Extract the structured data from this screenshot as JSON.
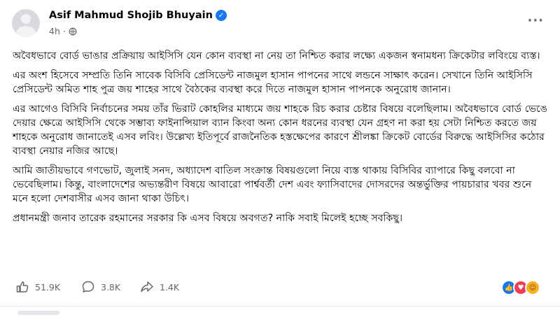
{
  "author": {
    "name": "Asif Mahmud Shojib Bhuyain",
    "time": "4h",
    "verified_icon": "verified-badge-icon",
    "audience_icon": "globe-icon"
  },
  "post": {
    "paragraphs": [
      "অবৈধভাবে বোর্ড ভাঙার প্রক্রিয়ায় আইসিসি যেন কোন ব্যবস্থা না নেয় তা নিশ্চিত করার লক্ষ্যে একজন স্বনামধন্য ক্রিকেটার লবিংয়ে ব্যস্ত।",
      "এর অংশ হিসেবে সম্প্রতি তিনি সাবেক বিসিবি প্রেসিডেন্ট নাজমুল হাসান পাপনের সাথে লন্ডনে সাক্ষাৎ করেন। সেখানে তিনি আইসিসি প্রেসিডেন্ট অমিত শাহ পুত্র জয় শাহের সাথে বৈঠকের ব্যবস্থা করে দিতে নাজমুল হাসান পাপনকে অনুরোধ জানান।",
      "এর আগেও বিসিবি নির্বাচনের সময় তাঁর ভিরাট কোহলির মাধ্যমে জয় শাহকে রিচ করার চেষ্টার বিষয়ে বলেছিলাম। অবৈধভাবে বোর্ড ভেঙে দেয়ার ক্ষেত্রে আইসিসি থেকে সম্ভাব্য ফাইনান্সিয়াল ব্যান কিংবা অন্য কোন ধরনের ব্যবস্থা যেন গ্রহণ না করা হয় সেটা নিশ্চিত করতে জয় শাহকে অনুরোধ জানাতেই এসব লবিং। উল্লেখ্য ইতিপূর্বে রাজনৈতিক হস্তক্ষেপের কারণে শ্রীলঙ্কা ক্রিকেট বোর্ডের বিরুদ্ধে আইসিসির কঠোর ব্যবস্থা নেয়ার নজির আছে।",
      "আমি জাতীয়ভাবে গণভোট, জুলাই সনদ, অধ্যাদেশ বাতিল সংক্রান্ত বিষয়গুলো নিয়ে ব্যস্ত থাকায় বিসিবির ব্যাপারে কিছু বলবো না ভেবেছিলাম। কিন্তু, বাংলাদেশের অভ্যন্তরীণ বিষয়ে আবারো পার্শ্ববর্তী দেশ এবং ফ্যাসিবাদের দোসরদের অন্তর্ভুক্তির পায়চারার খবর শুনে মনে হলো দেশবাসীর এসব জানা থাকা উচিৎ।",
      "প্রধানমন্ত্রী জনাব তারেক রহমানের সরকার কি এসব বিষয়ে অবগত? নাকি সবাই মিলেই হচ্ছে সবকিছু।"
    ]
  },
  "stats": {
    "likes": "51.9K",
    "comments": "3.8K",
    "shares": "1.4K",
    "reaction_icons": [
      "like-reaction-icon",
      "love-reaction-icon",
      "haha-reaction-icon"
    ]
  },
  "colors": {
    "accent": "#1877f2",
    "text": "#050505",
    "muted": "#65676b"
  }
}
